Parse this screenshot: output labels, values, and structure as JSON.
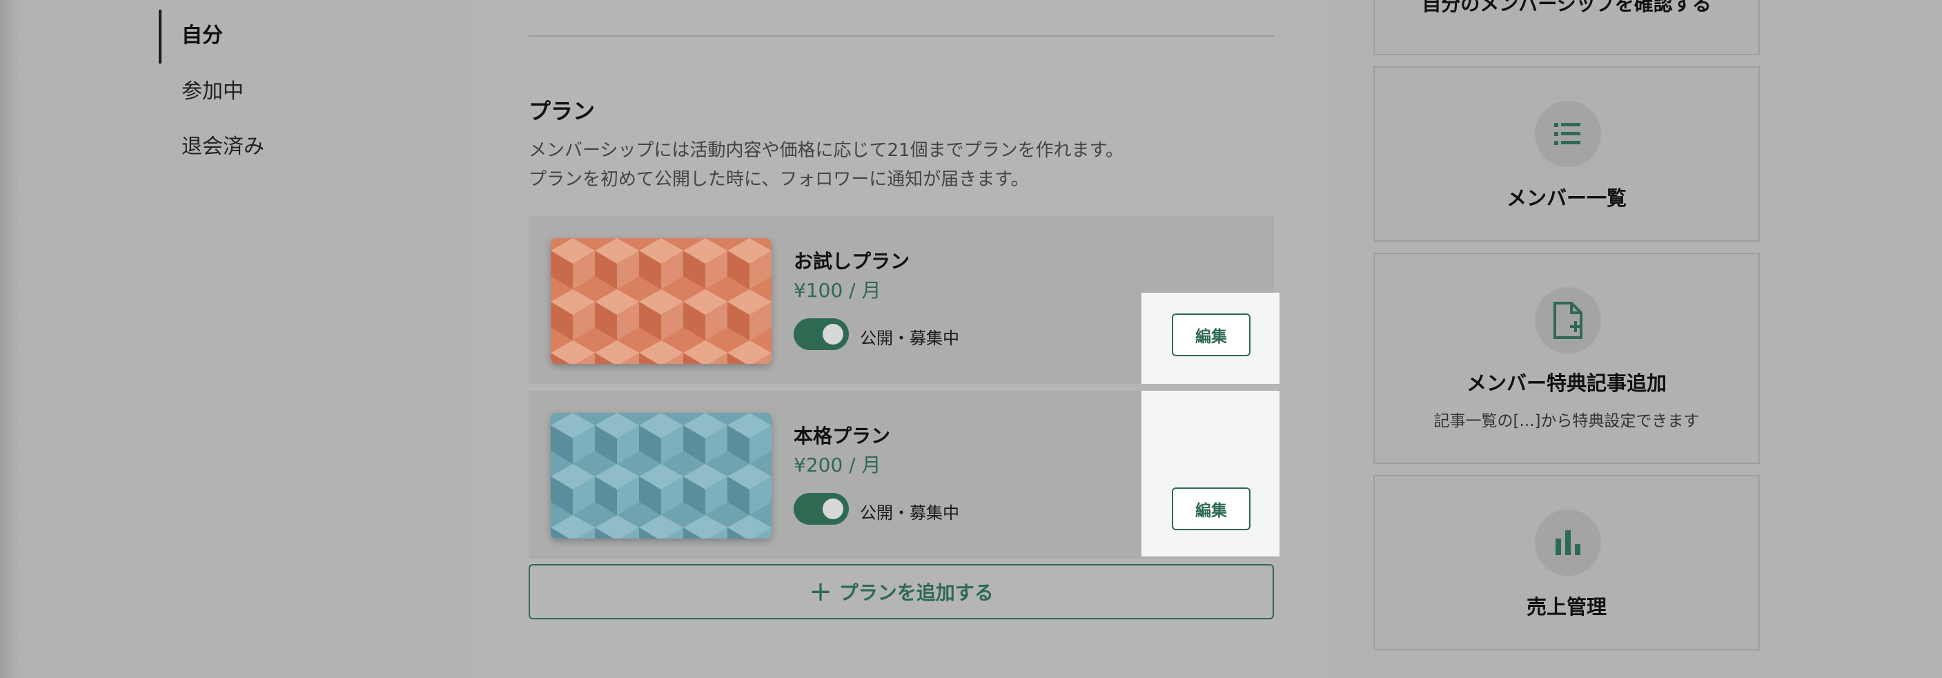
{
  "nav": {
    "items": [
      {
        "label": "自分",
        "active": true
      },
      {
        "label": "参加中",
        "active": false
      },
      {
        "label": "退会済み",
        "active": false
      }
    ]
  },
  "plans_section": {
    "title": "プラン",
    "desc_line1": "メンバーシップには活動内容や価格に応じて21個までプランを作れます。",
    "desc_line2": "プランを初めて公開した時に、フォロワーに通知が届きます。",
    "plans": [
      {
        "name": "お試しプラン",
        "price": "¥100 / 月",
        "status": "公開・募集中",
        "edit_label": "編集",
        "thumb_color": "#d9805f"
      },
      {
        "name": "本格プラン",
        "price": "¥200 / 月",
        "status": "公開・募集中",
        "edit_label": "編集",
        "thumb_color": "#6fa3b0"
      }
    ],
    "add_plan_label": "プランを追加する",
    "add_plan_icon": "+"
  },
  "sidebar": {
    "confirm_membership_label": "自分のメンバーシップを確認する",
    "member_list": {
      "label": "メンバー一覧",
      "icon": "list-icon"
    },
    "add_article": {
      "label": "メンバー特典記事追加",
      "sub": "記事一覧の[...]から特典設定できます",
      "icon": "document-plus-icon"
    },
    "sales": {
      "label": "売上管理",
      "icon": "bar-chart-icon"
    }
  },
  "colors": {
    "accent": "#2e6a52",
    "toggle_knob": "#d8d8d8"
  }
}
